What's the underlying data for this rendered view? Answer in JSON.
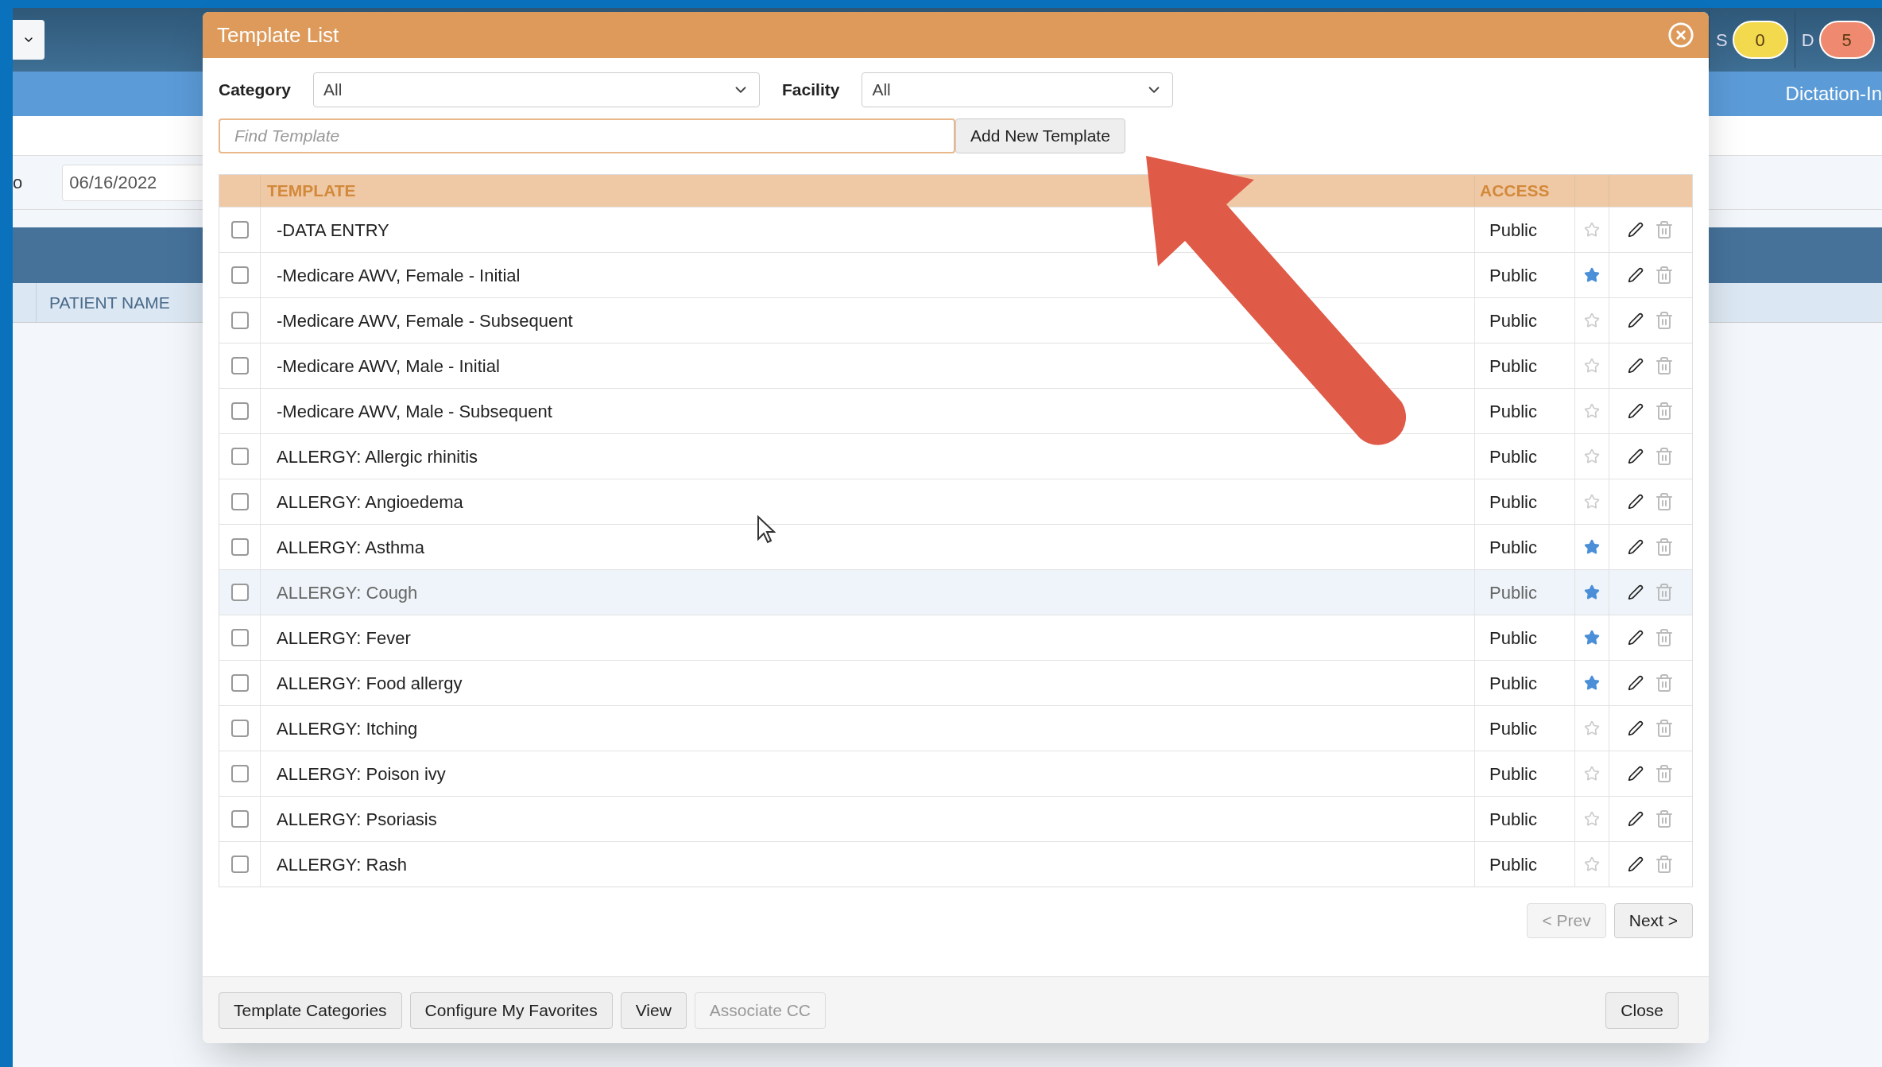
{
  "background": {
    "label_fragment": "o",
    "date": "06/16/2022",
    "column": "PATIENT NAME",
    "tab_fragment": "Dictation-In",
    "badges": [
      {
        "letter": "S",
        "count": "0",
        "color": "#f2d94e"
      },
      {
        "letter": "D",
        "count": "5",
        "color": "#ef8a70"
      }
    ]
  },
  "dialog": {
    "title": "Template List",
    "filters": [
      {
        "label": "Category",
        "value": "All"
      },
      {
        "label": "Facility",
        "value": "All"
      }
    ],
    "search": {
      "placeholder": "Find Template"
    },
    "add_button": "Add New Template",
    "columns": [
      "TEMPLATE",
      "ACCESS"
    ],
    "rows": [
      {
        "name": "-DATA ENTRY",
        "access": "Public",
        "checked": false,
        "favorite": false,
        "highlighted": false
      },
      {
        "name": "-Medicare AWV, Female - Initial",
        "access": "Public",
        "checked": false,
        "favorite": true,
        "highlighted": false
      },
      {
        "name": "-Medicare AWV, Female - Subsequent",
        "access": "Public",
        "checked": false,
        "favorite": false,
        "highlighted": false
      },
      {
        "name": "-Medicare AWV, Male - Initial",
        "access": "Public",
        "checked": false,
        "favorite": false,
        "highlighted": false
      },
      {
        "name": "-Medicare AWV, Male - Subsequent",
        "access": "Public",
        "checked": false,
        "favorite": false,
        "highlighted": false
      },
      {
        "name": "ALLERGY: Allergic rhinitis",
        "access": "Public",
        "checked": false,
        "favorite": false,
        "highlighted": false
      },
      {
        "name": "ALLERGY: Angioedema",
        "access": "Public",
        "checked": false,
        "favorite": false,
        "highlighted": false
      },
      {
        "name": "ALLERGY: Asthma",
        "access": "Public",
        "checked": false,
        "favorite": true,
        "highlighted": false
      },
      {
        "name": "ALLERGY: Cough",
        "access": "Public",
        "checked": false,
        "favorite": true,
        "highlighted": true
      },
      {
        "name": "ALLERGY: Fever",
        "access": "Public",
        "checked": false,
        "favorite": true,
        "highlighted": false
      },
      {
        "name": "ALLERGY: Food allergy",
        "access": "Public",
        "checked": false,
        "favorite": true,
        "highlighted": false
      },
      {
        "name": "ALLERGY: Itching",
        "access": "Public",
        "checked": false,
        "favorite": false,
        "highlighted": false
      },
      {
        "name": "ALLERGY: Poison ivy",
        "access": "Public",
        "checked": false,
        "favorite": false,
        "highlighted": false
      },
      {
        "name": "ALLERGY: Psoriasis",
        "access": "Public",
        "checked": false,
        "favorite": false,
        "highlighted": false
      },
      {
        "name": "ALLERGY: Rash",
        "access": "Public",
        "checked": false,
        "favorite": false,
        "highlighted": false
      }
    ],
    "pager": [
      {
        "label": "< Prev",
        "disabled": true
      },
      {
        "label": "Next >",
        "disabled": false
      }
    ],
    "footer_buttons": [
      {
        "label": "Template Categories",
        "disabled": false
      },
      {
        "label": "Configure My Favorites",
        "disabled": false
      },
      {
        "label": "View",
        "disabled": false
      },
      {
        "label": "Associate CC",
        "disabled": true
      }
    ],
    "close_button": "Close"
  }
}
